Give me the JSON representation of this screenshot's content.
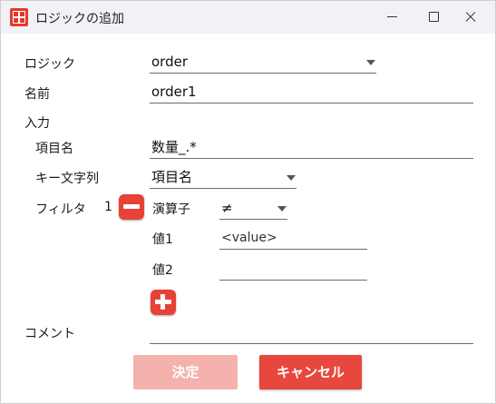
{
  "window": {
    "title": "ロジックの追加"
  },
  "logic": {
    "label": "ロジック",
    "value": "order"
  },
  "name": {
    "label": "名前",
    "value": "order1"
  },
  "input_section": {
    "label": "入力",
    "item_name": {
      "label": "項目名",
      "value": "数量_.*"
    },
    "key_string": {
      "label": "キー文字列",
      "value": "項目名"
    },
    "filter": {
      "label": "フィルタ",
      "index": "1",
      "operator": {
        "label": "演算子",
        "value": "≠"
      },
      "value1": {
        "label": "値1",
        "placeholder": "<value>"
      },
      "value2": {
        "label": "値2",
        "value": ""
      }
    }
  },
  "comment": {
    "label": "コメント",
    "value": ""
  },
  "buttons": {
    "ok": "決定",
    "cancel": "キャンセル"
  },
  "colors": {
    "accent": "#e8473d",
    "accent_disabled": "#f5b1ac",
    "titlebar": "#f1f2f6"
  }
}
